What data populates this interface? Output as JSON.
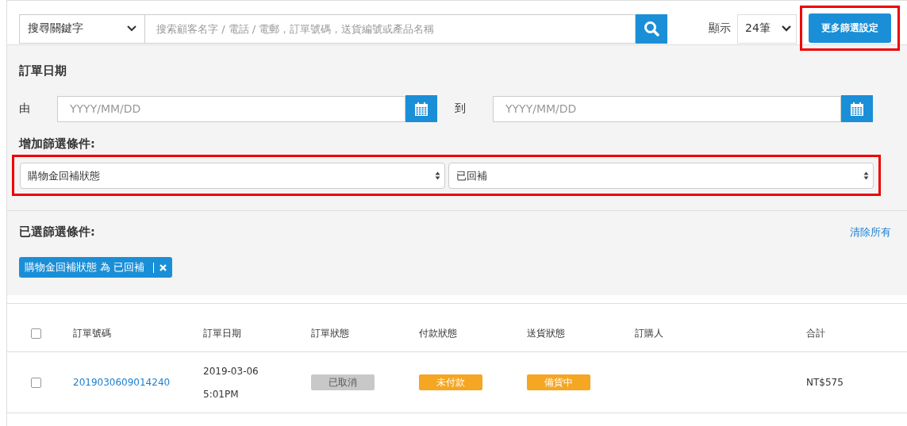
{
  "search_bar": {
    "keyword_select": "搜尋關鍵字",
    "search": {
      "placeholder": "搜索顧客名字 / 電話 / 電郵，訂單號碼，送貨編號或產品名稱"
    },
    "show_label": "顯示",
    "page_size": "24筆",
    "more_filters_button": {
      "label": "更多篩選設定",
      "highlighted": true
    }
  },
  "date_filter": {
    "title": "訂單日期",
    "from_label": "由",
    "from": {
      "placeholder": "YYYY/MM/DD"
    },
    "to_label": "到",
    "to": {
      "placeholder": "YYYY/MM/DD"
    }
  },
  "add_filter": {
    "title": "增加篩選條件:",
    "highlighted": true,
    "field": "購物金回補狀態",
    "value": "已回補"
  },
  "selected_filters": {
    "title": "已選篩選條件:",
    "clear_all": "清除所有",
    "tags": [
      {
        "label": "購物金回補狀態 為 已回補"
      }
    ]
  },
  "table": {
    "select_all_checked": false,
    "columns": [
      "訂單號碼",
      "訂單日期",
      "訂單狀態",
      "付款狀態",
      "送貨狀態",
      "訂購人",
      "合計"
    ],
    "rows": [
      {
        "checked": false,
        "order_no": "2019030609014240",
        "date": "2019-03-06",
        "time": "5:01PM",
        "statuses": [
          {
            "label": "已取消",
            "color": "#c8c8c8"
          },
          {
            "label": "未付款",
            "color": "#f5a623"
          },
          {
            "label": "備貨中",
            "color": "#f5a623"
          }
        ],
        "total": "NT$575"
      }
    ]
  }
}
